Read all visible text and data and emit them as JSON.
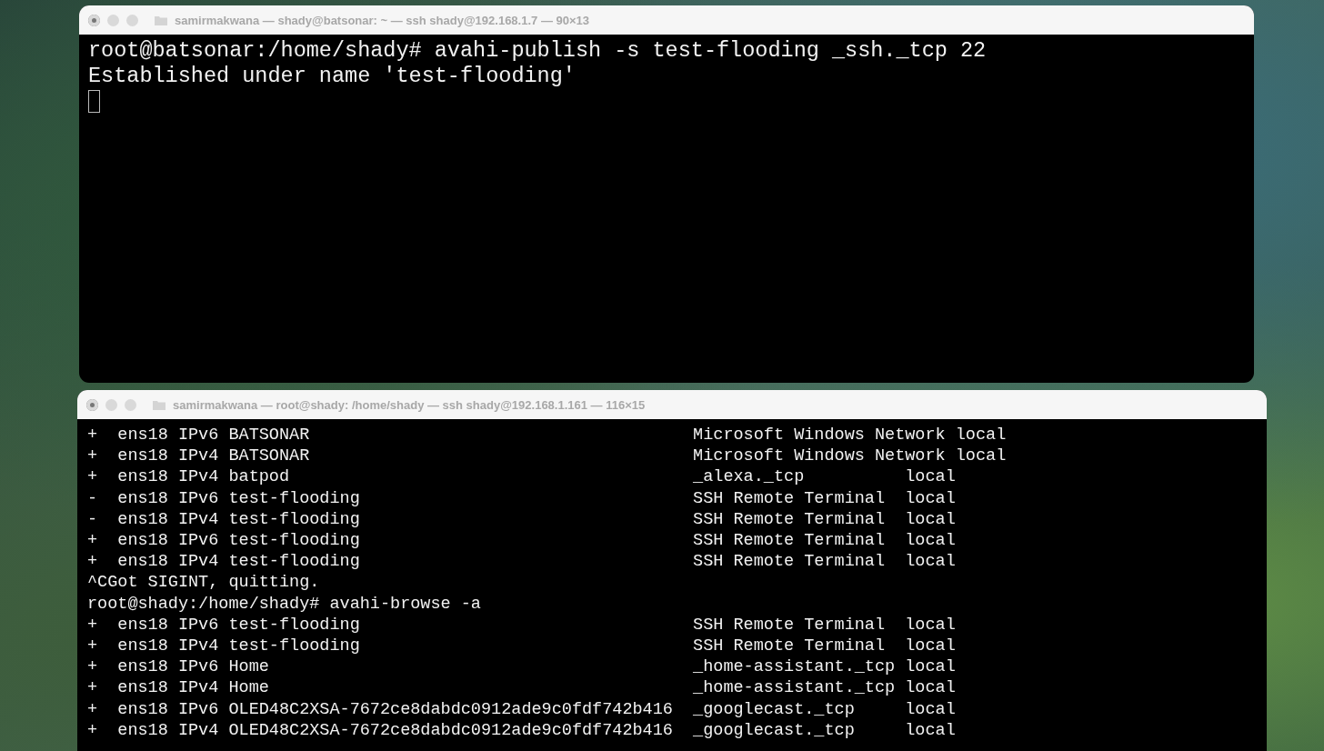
{
  "windows": [
    {
      "title": "samirmakwana — shady@batsonar: ~ — ssh shady@192.168.1.7 — 90×13",
      "cursor": true,
      "lines": [
        {
          "kind": "text",
          "text": "root@batsonar:/home/shady# avahi-publish -s test-flooding _ssh._tcp 22"
        },
        {
          "kind": "text",
          "text": "Established under name 'test-flooding'"
        }
      ]
    },
    {
      "title": "samirmakwana — root@shady: /home/shady — ssh shady@192.168.1.161 — 116×15",
      "cursor": false,
      "lines": [
        {
          "kind": "entry",
          "sign": "+",
          "interface": "ens18",
          "protocol": "IPv6",
          "name": "BATSONAR",
          "type": "Microsoft Windows Network",
          "domain": "local"
        },
        {
          "kind": "entry",
          "sign": "+",
          "interface": "ens18",
          "protocol": "IPv4",
          "name": "BATSONAR",
          "type": "Microsoft Windows Network",
          "domain": "local"
        },
        {
          "kind": "entry",
          "sign": "+",
          "interface": "ens18",
          "protocol": "IPv4",
          "name": "batpod",
          "type": "_alexa._tcp",
          "domain": "local"
        },
        {
          "kind": "entry",
          "sign": "-",
          "interface": "ens18",
          "protocol": "IPv6",
          "name": "test-flooding",
          "type": "SSH Remote Terminal",
          "domain": "local"
        },
        {
          "kind": "entry",
          "sign": "-",
          "interface": "ens18",
          "protocol": "IPv4",
          "name": "test-flooding",
          "type": "SSH Remote Terminal",
          "domain": "local"
        },
        {
          "kind": "entry",
          "sign": "+",
          "interface": "ens18",
          "protocol": "IPv6",
          "name": "test-flooding",
          "type": "SSH Remote Terminal",
          "domain": "local"
        },
        {
          "kind": "entry",
          "sign": "+",
          "interface": "ens18",
          "protocol": "IPv4",
          "name": "test-flooding",
          "type": "SSH Remote Terminal",
          "domain": "local"
        },
        {
          "kind": "text",
          "text": "^CGot SIGINT, quitting."
        },
        {
          "kind": "text",
          "text": "root@shady:/home/shady# avahi-browse -a"
        },
        {
          "kind": "entry",
          "sign": "+",
          "interface": "ens18",
          "protocol": "IPv6",
          "name": "test-flooding",
          "type": "SSH Remote Terminal",
          "domain": "local"
        },
        {
          "kind": "entry",
          "sign": "+",
          "interface": "ens18",
          "protocol": "IPv4",
          "name": "test-flooding",
          "type": "SSH Remote Terminal",
          "domain": "local"
        },
        {
          "kind": "entry",
          "sign": "+",
          "interface": "ens18",
          "protocol": "IPv6",
          "name": "Home",
          "type": "_home-assistant._tcp",
          "domain": "local"
        },
        {
          "kind": "entry",
          "sign": "+",
          "interface": "ens18",
          "protocol": "IPv4",
          "name": "Home",
          "type": "_home-assistant._tcp",
          "domain": "local"
        },
        {
          "kind": "entry",
          "sign": "+",
          "interface": "ens18",
          "protocol": "IPv6",
          "name": "OLED48C2XSA-7672ce8dabdc0912ade9c0fdf742b416",
          "type": "_googlecast._tcp",
          "domain": "local"
        },
        {
          "kind": "entry",
          "sign": "+",
          "interface": "ens18",
          "protocol": "IPv4",
          "name": "OLED48C2XSA-7672ce8dabdc0912ade9c0fdf742b416",
          "type": "_googlecast._tcp",
          "domain": "local"
        }
      ]
    }
  ]
}
